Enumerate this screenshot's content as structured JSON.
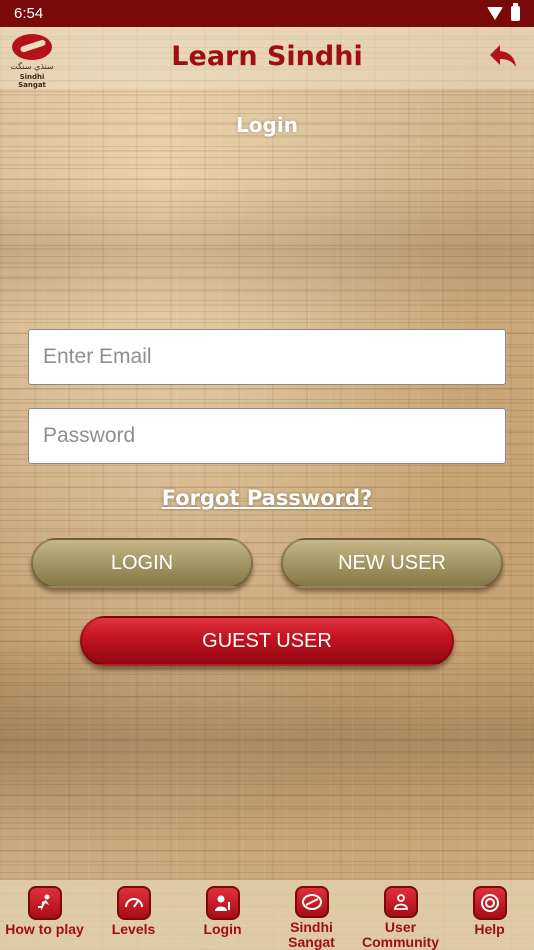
{
  "status_bar": {
    "time": "6:54"
  },
  "app_bar": {
    "title": "Learn Sindhi",
    "logo_urdu": "سنڌي سنگت",
    "logo_text": "Sindhi Sangat",
    "back_icon": "back-arrow-icon"
  },
  "login": {
    "heading": "Login",
    "email_placeholder": "Enter Email",
    "password_placeholder": "Password",
    "forgot_link": "Forgot Password? ",
    "login_button": "LOGIN",
    "new_user_button": "NEW USER",
    "guest_button": "GUEST USER"
  },
  "bottom_nav": {
    "items": [
      {
        "label": "How to play",
        "icon": "person-play-icon"
      },
      {
        "label": "Levels",
        "icon": "gauge-icon"
      },
      {
        "label": "Login",
        "icon": "user-login-icon"
      },
      {
        "label": "Sindhi Sangat",
        "icon": "sindhi-sangat-logo-icon"
      },
      {
        "label": "User Community",
        "icon": "community-icon"
      },
      {
        "label": "Help",
        "icon": "lifebuoy-icon"
      }
    ]
  },
  "colors": {
    "status_bar": "#7a0a0a",
    "brand_red": "#a10e12",
    "button_olive": "#a89968",
    "button_red": "#c2121f"
  }
}
